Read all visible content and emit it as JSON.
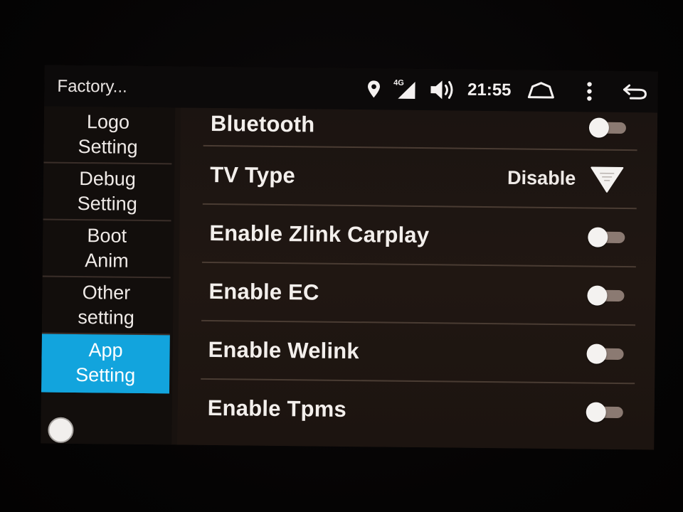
{
  "statusbar": {
    "app_title": "Factory...",
    "time": "21:55",
    "network_label": "4G",
    "icons": [
      "location-pin-icon",
      "signal-4g-icon",
      "volume-icon",
      "home-icon",
      "menu-dots-icon",
      "back-icon"
    ]
  },
  "sidebar": {
    "items": [
      {
        "label": "Logo\nSetting",
        "active": false
      },
      {
        "label": "Debug\nSetting",
        "active": false
      },
      {
        "label": "Boot\nAnim",
        "active": false
      },
      {
        "label": "Other\nsetting",
        "active": false
      },
      {
        "label": "App\nSetting",
        "active": true
      }
    ]
  },
  "settings": {
    "rows": [
      {
        "label": "Bluetooth",
        "type": "toggle",
        "enabled": false
      },
      {
        "label": "TV Type",
        "type": "select",
        "value": "Disable"
      },
      {
        "label": "Enable Zlink Carplay",
        "type": "toggle",
        "enabled": false
      },
      {
        "label": "Enable EC",
        "type": "toggle",
        "enabled": false
      },
      {
        "label": "Enable Welink",
        "type": "toggle",
        "enabled": false
      },
      {
        "label": "Enable Tpms",
        "type": "toggle",
        "enabled": false
      }
    ]
  },
  "colors": {
    "accent": "#12a4dd",
    "background": "#18120f",
    "text": "#f3efec",
    "toggle_track_off": "#8b7a72",
    "toggle_knob": "#f4f2f0"
  }
}
